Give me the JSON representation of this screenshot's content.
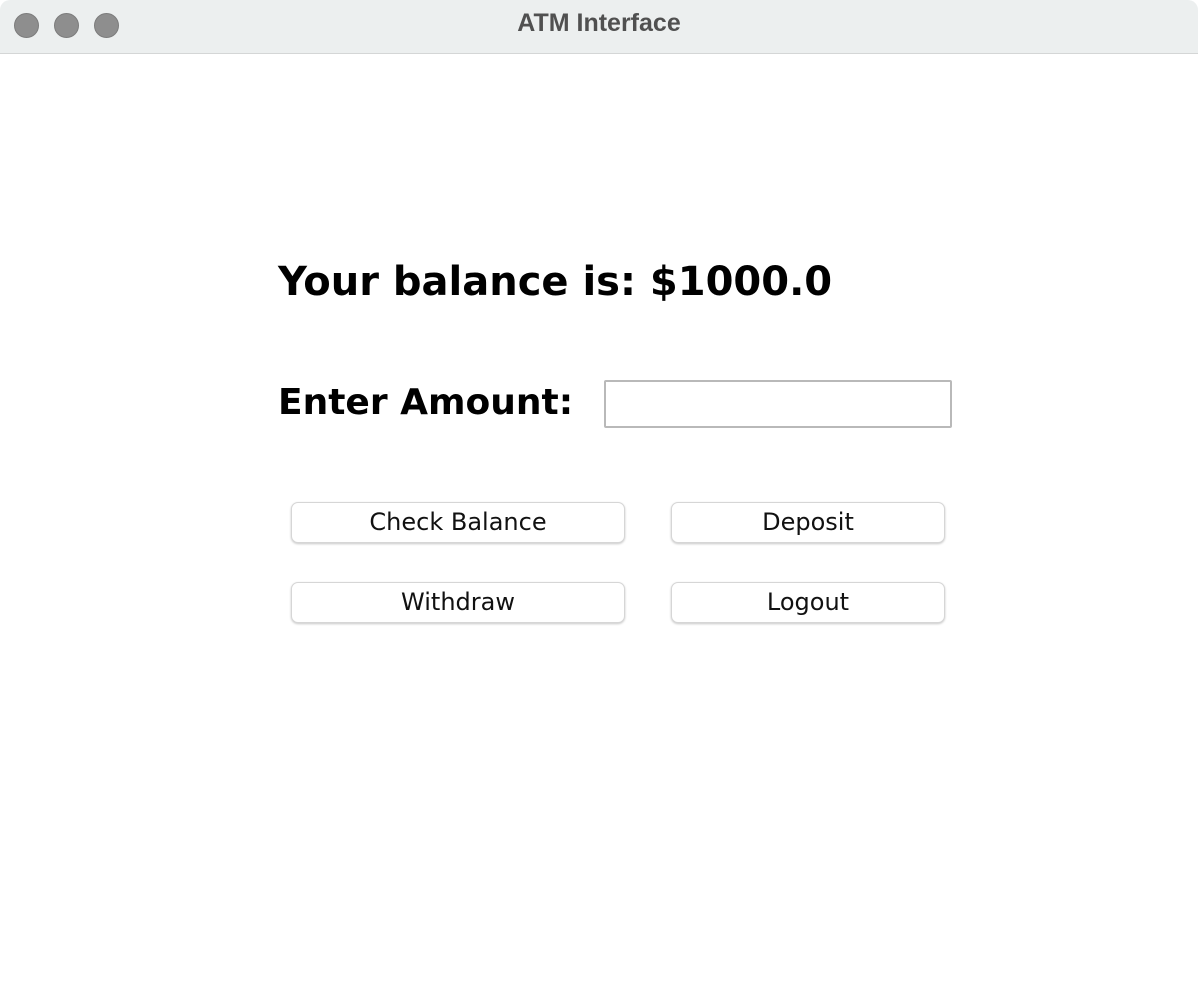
{
  "window": {
    "title": "ATM Interface"
  },
  "main": {
    "balance_text": "Your balance is: $1000.0",
    "amount_label": "Enter Amount:",
    "amount_input": {
      "value": "",
      "placeholder": ""
    }
  },
  "buttons": {
    "check_balance": "Check Balance",
    "deposit": "Deposit",
    "withdraw": "Withdraw",
    "logout": "Logout"
  }
}
